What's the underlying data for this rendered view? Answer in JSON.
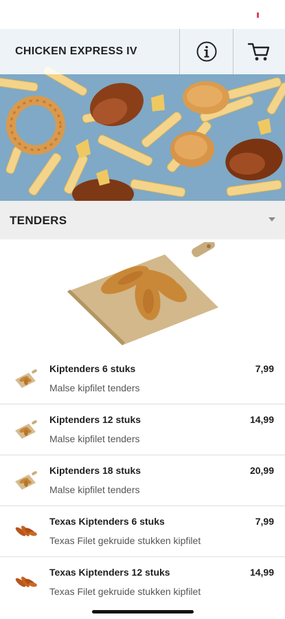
{
  "header": {
    "title": "CHICKEN EXPRESS IV"
  },
  "icons": {
    "info": "info-icon",
    "cart": "cart-icon"
  },
  "category": {
    "title": "TENDERS"
  },
  "items": [
    {
      "name": "Kiptenders 6 stuks",
      "description": "Malse kipfilet tenders",
      "price": "7,99",
      "thumb": "tenders-board"
    },
    {
      "name": "Kiptenders 12 stuks",
      "description": "Malse kipfilet tenders",
      "price": "14,99",
      "thumb": "tenders-board"
    },
    {
      "name": "Kiptenders 18 stuks",
      "description": "Malse kipfilet tenders",
      "price": "20,99",
      "thumb": "tenders-board"
    },
    {
      "name": "Texas Kiptenders 6 stuks",
      "description": "Texas Filet gekruide stukken kipfilet",
      "price": "7,99",
      "thumb": "texas-tenders"
    },
    {
      "name": "Texas Kiptenders 12 stuks",
      "description": "Texas Filet gekruide stukken kipfilet",
      "price": "14,99",
      "thumb": "texas-tenders"
    }
  ],
  "colors": {
    "category_bar": "#eeeeee",
    "hero_bg": "#7aa6c4",
    "divider": "#dedede"
  }
}
